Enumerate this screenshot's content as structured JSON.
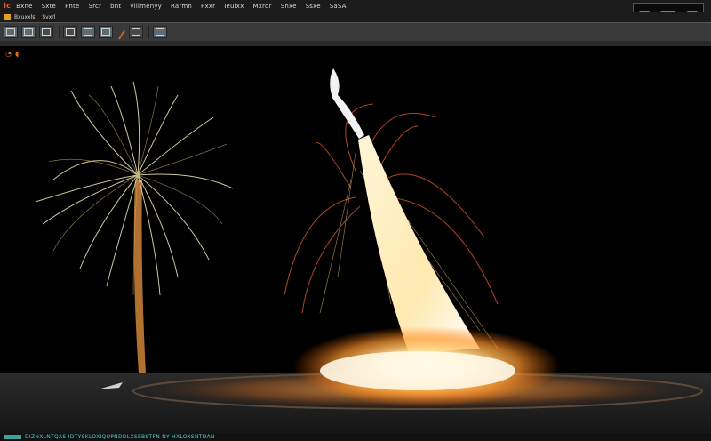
{
  "menubar": {
    "logo": "Ic",
    "items": [
      "Bxne",
      "Sxte",
      "Pnte",
      "Srcr",
      "bnt",
      "vilimenyy",
      "Rarmn",
      "Pxxr",
      "Ieulxx",
      "Mxrdr",
      "Snxe",
      "Ssxe",
      "SaSA"
    ],
    "window_controls": [
      "▂▂",
      "▂▂▂",
      "▂▂"
    ]
  },
  "project": {
    "label_1": "Bxuxxls",
    "label_2": "Svxrl"
  },
  "toolbar": {
    "tools": [
      "view-tool",
      "grid-tool",
      "render-tool",
      "camera-tool",
      "layout-tool",
      "display-tool",
      "pen-tool",
      "light-tool",
      "settings-tool"
    ]
  },
  "viewport": {
    "icons": [
      "◔",
      "◖"
    ]
  },
  "statusbar": {
    "text": "DIZNXLNTQAS IDTYSKLOXIQUPNDDLXSEBSTFN NY HXLOXSNTDAN"
  },
  "colors": {
    "accent": "#e85a1a",
    "toolbar": "#3a3a3a",
    "status": "#4fd0c8"
  }
}
